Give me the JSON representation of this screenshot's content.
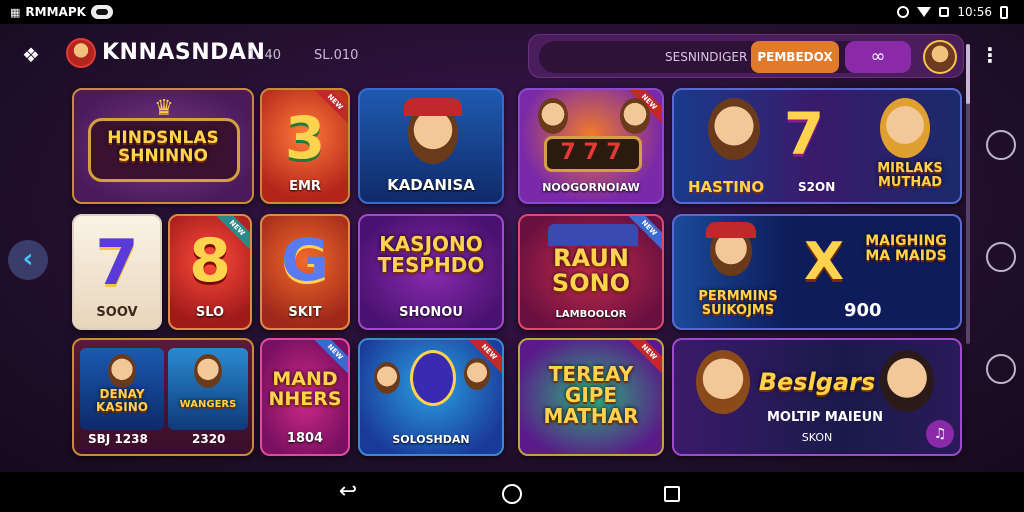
{
  "status_bar": {
    "app_name": "RMMAPK",
    "time": "10:56",
    "icons": [
      "notification-icon",
      "message-pill-icon",
      "dnd-icon",
      "wifi-icon",
      "battery-icon"
    ]
  },
  "header": {
    "title": "KNNASNDAN",
    "stat_1": "1. 40",
    "stat_2": "SL.010",
    "search_placeholder": "SESNINDIGER",
    "cta_label": "PEMBEDOX",
    "link_icon": "link-icon",
    "more_icon": "more-vert-icon"
  },
  "sidebar_right_icons": [
    "chat-icon",
    "search-icon",
    "profile-icon"
  ],
  "nav": {
    "left_arrow_icon": "chevron-left-icon"
  },
  "tiles": [
    {
      "id": "t1",
      "title": "HINDSNLAS SHNINNO",
      "label": ""
    },
    {
      "id": "t2",
      "big": "3",
      "label": "EMR"
    },
    {
      "id": "t3",
      "label": "KADANISA"
    },
    {
      "id": "t4",
      "big": "7 7 7",
      "label": "NOOGORNOIAW"
    },
    {
      "id": "t5",
      "big": "7",
      "label_left": "HASTINO",
      "label_mid": "S2ON",
      "title": "MIRLAKS MUTHAD"
    },
    {
      "id": "t6",
      "big": "7",
      "label": "SOOV"
    },
    {
      "id": "t7",
      "big": "8",
      "label": "SLO"
    },
    {
      "id": "t8",
      "big": "G",
      "label": "SKIT"
    },
    {
      "id": "t9",
      "title": "KASJONO TESPHDO",
      "label": "SHONOU"
    },
    {
      "id": "t10",
      "title": "RAUN SONO",
      "label": "LAMBOOLOR"
    },
    {
      "id": "t11",
      "title": "PERMMINS SUIKOJMS",
      "big": "X",
      "title2": "MAIGHING MA MAIDS",
      "label": "900"
    },
    {
      "id": "t12",
      "title": "DENAY KASINO",
      "label": "SBJ 1238"
    },
    {
      "id": "t13",
      "title": "WANGERS",
      "label": "2320"
    },
    {
      "id": "t14",
      "title": "MAND NHERS",
      "label": "1804"
    },
    {
      "id": "t15",
      "label": "SOLOSHDAN"
    },
    {
      "id": "t16",
      "title": "TEREAY GIPE MATHAR",
      "label": ""
    },
    {
      "id": "t17",
      "title": "Beslgars",
      "title2": "MOLTIP MAIEUN",
      "label": "SKON"
    }
  ],
  "ribbon_text": "NEW",
  "colors": {
    "background": "#24102f",
    "accent": "#e07a2c",
    "purple": "#8a2aa8",
    "gold": "#ffd34d"
  },
  "system_nav": [
    "back-icon",
    "home-icon",
    "recent-apps-icon"
  ]
}
